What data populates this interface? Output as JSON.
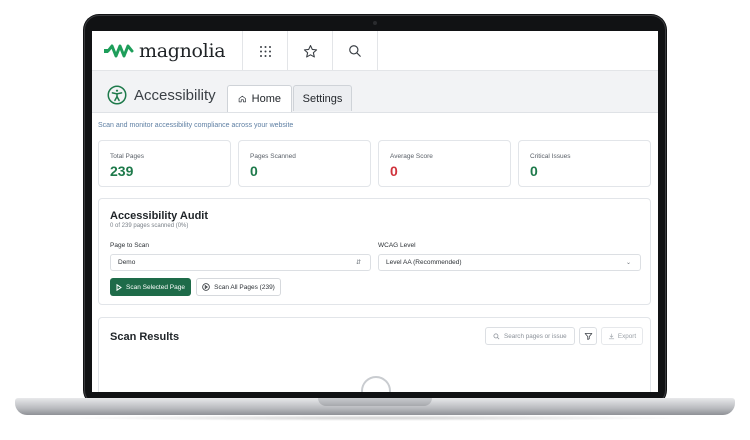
{
  "brand": {
    "name": "magnolia",
    "mark_color": "#1e9e5a"
  },
  "topbar": {
    "icons": [
      "apps-grid-icon",
      "star-icon",
      "search-icon"
    ]
  },
  "app": {
    "title": "Accessibility",
    "tabs": [
      {
        "label": "Home",
        "icon": "home-icon",
        "active": true
      },
      {
        "label": "Settings",
        "active": false
      }
    ],
    "subtitle": "Scan and monitor accessibility compliance across your website"
  },
  "stats": [
    {
      "label": "Total Pages",
      "value": "239",
      "color": "#1e7a4b"
    },
    {
      "label": "Pages Scanned",
      "value": "0",
      "color": "#1e7a4b"
    },
    {
      "label": "Average Score",
      "value": "0",
      "color": "#d0333c"
    },
    {
      "label": "Critical Issues",
      "value": "0",
      "color": "#1e7a4b"
    }
  ],
  "audit": {
    "title": "Accessibility Audit",
    "progress_text": "0 of 239 pages scanned (0%)",
    "page_label": "Page to Scan",
    "page_value": "Demo",
    "wcag_label": "WCAG Level",
    "wcag_value": "Level AA (Recommended)",
    "scan_selected_label": "Scan Selected Page",
    "scan_all_label": "Scan All Pages (239)"
  },
  "results": {
    "title": "Scan Results",
    "search_placeholder": "Search pages or issue",
    "export_label": "Export"
  }
}
